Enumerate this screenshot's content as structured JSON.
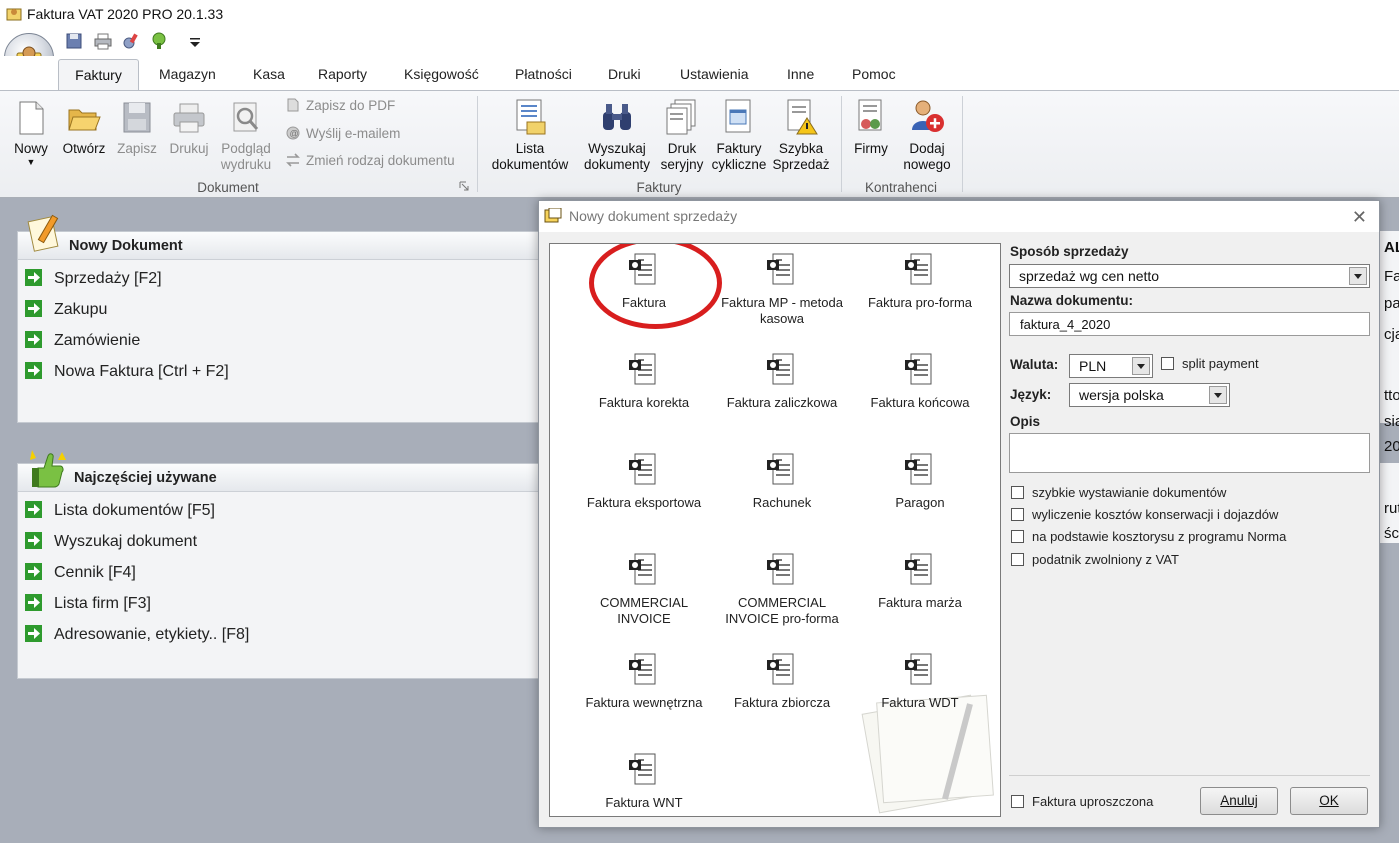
{
  "window": {
    "title": "Faktura VAT 2020 PRO 20.1.33"
  },
  "tabs": [
    "Faktury",
    "Magazyn",
    "Kasa",
    "Raporty",
    "Księgowość",
    "Płatności",
    "Druki",
    "Ustawienia",
    "Inne",
    "Pomoc"
  ],
  "ribbon": {
    "nowy": "Nowy",
    "otworz": "Otwórz",
    "zapisz": "Zapisz",
    "drukuj": "Drukuj",
    "podglad_1": "Podgląd",
    "podglad_2": "wydruku",
    "pdf": "Zapisz do PDF",
    "email": "Wyślij e-mailem",
    "zmien": "Zmień rodzaj dokumentu",
    "group_dokument": "Dokument",
    "lista_1": "Lista",
    "lista_2": "dokumentów",
    "wyszukaj_1": "Wyszukaj",
    "wyszukaj_2": "dokumenty",
    "druk_1": "Druk",
    "druk_2": "seryjny",
    "cykl_1": "Faktury",
    "cykl_2": "cykliczne",
    "szybka_1": "Szybka",
    "szybka_2": "Sprzedaż",
    "group_faktury": "Faktury",
    "firmy": "Firmy",
    "dodaj_1": "Dodaj",
    "dodaj_2": "nowego",
    "group_kontrahenci": "Kontrahenci"
  },
  "panel_new": {
    "title": "Nowy Dokument",
    "items": [
      "Sprzedaży [F2]",
      "Zakupu",
      "Zamówienie",
      "Nowa Faktura [Ctrl + F2]"
    ]
  },
  "panel_frequent": {
    "title": "Najczęściej używane",
    "items": [
      "Lista dokumentów [F5]",
      "Wyszukaj dokument",
      "Cennik [F4]",
      "Lista firm [F3]",
      "Adresowanie, etykiety.. [F8]"
    ]
  },
  "bg_right_fragments": [
    "AL",
    "Fa",
    "pa",
    "cja",
    "tto",
    "sia",
    "20",
    "rut",
    "ści"
  ],
  "dialog": {
    "title": "Nowy dokument sprzedaży",
    "documents": [
      [
        "Faktura"
      ],
      [
        "Faktura MP - metoda",
        "kasowa"
      ],
      [
        "Faktura pro-forma"
      ],
      [
        "Faktura korekta"
      ],
      [
        "Faktura zaliczkowa"
      ],
      [
        "Faktura końcowa"
      ],
      [
        "Faktura eksportowa"
      ],
      [
        "Rachunek"
      ],
      [
        "Paragon"
      ],
      [
        "COMMERCIAL",
        "INVOICE"
      ],
      [
        "COMMERCIAL",
        "INVOICE pro-forma"
      ],
      [
        "Faktura marża"
      ],
      [
        "Faktura wewnętrzna"
      ],
      [
        "Faktura zbiorcza"
      ],
      [
        "Faktura WDT"
      ],
      [
        "Faktura WNT"
      ]
    ],
    "sposob_label": "Sposób sprzedaży",
    "sposob_value": "sprzedaż wg cen netto",
    "nazwa_label": "Nazwa dokumentu:",
    "nazwa_value": "faktura_4_2020",
    "waluta_label": "Waluta:",
    "waluta_value": "PLN",
    "split_label": "split payment",
    "jezyk_label": "Język:",
    "jezyk_value": "wersja polska",
    "opis_label": "Opis",
    "options": [
      "szybkie wystawianie dokumentów",
      "wyliczenie kosztów konserwacji i dojazdów",
      "na podstawie kosztorysu z programu Norma",
      "podatnik zwolniony z VAT"
    ],
    "uproszczona_label": "Faktura uproszczona",
    "anuluj": "Anuluj",
    "ok": "OK"
  },
  "colors": {
    "highlight_circle": "#d81e1e",
    "workspace": "#a8aeb9",
    "arrow_green": "#2e9a2e"
  }
}
